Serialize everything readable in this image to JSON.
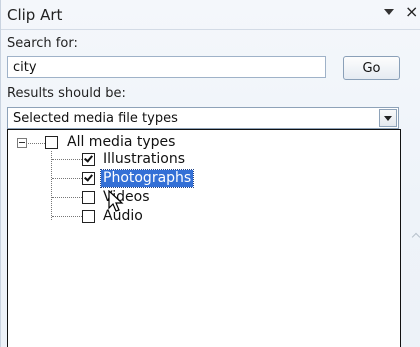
{
  "pane": {
    "title": "Clip Art",
    "menu_icon": "chevron-down-icon",
    "close_label": "×"
  },
  "search": {
    "label": "Search for:",
    "value": "city",
    "go_label": "Go"
  },
  "results": {
    "label": "Results should be:",
    "selected_value": "Selected media file types"
  },
  "media_tree": {
    "root": {
      "label": "All media types",
      "checked": false,
      "expanded": true
    },
    "items": [
      {
        "label": "Illustrations",
        "checked": true,
        "selected": false
      },
      {
        "label": "Photographs",
        "checked": true,
        "selected": true
      },
      {
        "label": "Videos",
        "checked": false,
        "selected": false
      },
      {
        "label": "Audio",
        "checked": false,
        "selected": false
      }
    ]
  },
  "colors": {
    "selection": "#3470d6",
    "pane_background": "#eef3f9"
  }
}
